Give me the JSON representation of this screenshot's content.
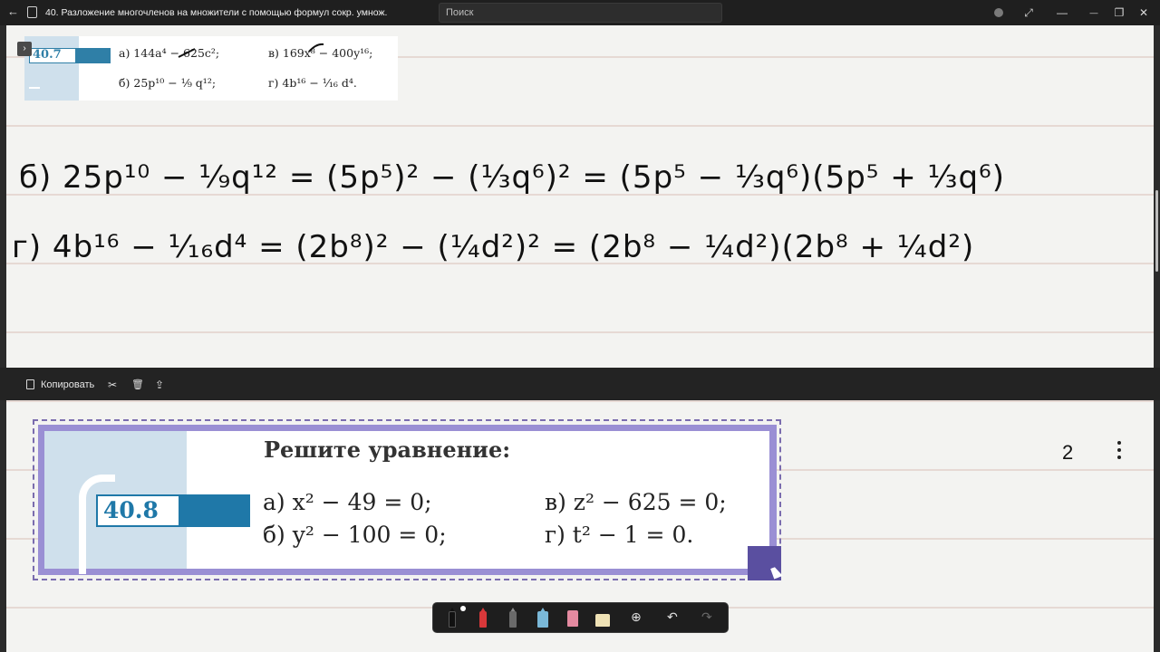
{
  "window": {
    "back_glyph": "←",
    "title": "40. Разложение многочленов на множители с помощью формул сокр. умнож.",
    "search_placeholder": "Поиск",
    "controls": [
      "avatar-icon",
      "fullscreen-icon",
      "minimize-icon",
      "restore-icon",
      "close-icon"
    ],
    "fullscreen_glyph": "⤢",
    "minimize_glyph": "—",
    "restore_glyph": "❐",
    "close_glyph": "✕"
  },
  "page1": {
    "expand_glyph": "›",
    "exercise_number": "40.7",
    "problems": {
      "a": "а) 144a⁴ − 625c²;",
      "b": "б) 25p¹⁰ − ¹⁄₉ q¹²;",
      "v": "в) 169x⁸ − 400y¹⁶;",
      "g": "г) 4b¹⁶ − ¹⁄₁₆ d⁴."
    },
    "handwriting": {
      "line1": "б) 25p¹⁰ − ¹⁄₉q¹² = (5p⁵)² − (⅓q⁶)² = (5p⁵ − ⅓q⁶)(5p⁵ + ⅓q⁶)",
      "line2": "г) 4b¹⁶ − ¹⁄₁₆d⁴ = (2b⁸)² − (¼d²)² = (2b⁸ − ¼d²)(2b⁸ + ¼d²)"
    }
  },
  "selection_toolbar": {
    "copy_label": "Копировать",
    "cut_glyph": "✂",
    "delete_glyph": "🗑",
    "share_glyph": "⇪"
  },
  "page2": {
    "exercise_number": "40.8",
    "title": "Решите уравнение:",
    "equations": {
      "a": "а) x² − 49 = 0;",
      "b": "б) y² − 100 = 0;",
      "v": "в) z² − 625 = 0;",
      "g": "г) t² − 1 = 0."
    },
    "page_number": "2"
  },
  "pen_toolbar": {
    "tools": [
      "black-pen",
      "red-marker",
      "pencil",
      "highlighter",
      "eraser",
      "lasso-tape"
    ],
    "add_glyph": "⊕",
    "undo_glyph": "↶",
    "redo_glyph": "↷",
    "colors": {
      "black_pen": "#111111",
      "red_marker": "#d8383a",
      "pencil": "#8a8a8a",
      "highlighter": "#7ab8d8",
      "eraser": "#e48aa0",
      "tape": "#efe2b5"
    }
  },
  "colors": {
    "textbook_blue": "#1f78a8",
    "selection_purple": "#9a8fd4",
    "handle_purple": "#5a4fa0",
    "page_rule": "#e6d9d4"
  }
}
